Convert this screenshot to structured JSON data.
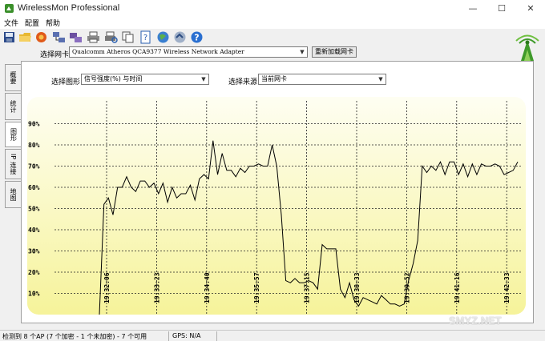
{
  "window": {
    "title": "WirelessMon Professional",
    "minimize": "—",
    "maximize": "☐",
    "close": "✕"
  },
  "menu": [
    "文件",
    "配置",
    "帮助"
  ],
  "toolbar": {
    "icons": [
      "save-icon",
      "open-folder-icon",
      "record-icon",
      "network-icon",
      "adapter-icon",
      "print-icon",
      "print-preview-icon",
      "copy-icon",
      "info-icon",
      "globe-icon",
      "connect-icon",
      "help-icon"
    ]
  },
  "adapter": {
    "label": "选择网卡",
    "selected": "Qualcomm Atheros QCA9377 Wireless Network Adapter",
    "reload": "重新加载网卡"
  },
  "tabs": [
    "概要",
    "统计",
    "图形",
    "IP 连接",
    "地图"
  ],
  "graph_controls": {
    "graph_label": "选择图形",
    "graph_selected": "信号强度(%) 与时间",
    "source_label": "选择来源",
    "source_selected": "当前网卡"
  },
  "chart_data": {
    "type": "line",
    "ylabels": [
      "10%",
      "20%",
      "30%",
      "40%",
      "50%",
      "60%",
      "70%",
      "80%",
      "90%"
    ],
    "xlabels": [
      "19:32:06",
      "19:33:23",
      "19:34:40",
      "19:35:57",
      "19:37:15",
      "19:38:33",
      "19:39:52",
      "19:41:16",
      "19:42:33"
    ],
    "ylim": [
      0,
      100
    ],
    "grid": true,
    "series": [
      {
        "values": [
          0,
          52,
          55,
          47,
          60,
          60,
          65,
          60,
          58,
          63,
          63,
          60,
          62,
          57,
          62,
          53,
          60,
          55,
          57,
          57,
          61,
          54,
          64,
          66,
          64,
          82,
          66,
          76,
          68,
          68,
          65,
          69,
          67,
          70,
          70,
          71,
          70,
          70,
          80,
          70,
          47,
          16,
          15,
          17,
          15,
          15,
          16,
          15,
          12,
          33,
          31,
          31,
          31,
          12,
          8,
          15,
          7,
          4,
          8,
          7,
          6,
          5,
          9,
          7,
          5,
          5,
          4,
          5,
          16,
          24,
          35,
          70,
          67,
          70,
          68,
          72,
          66,
          72,
          72,
          66,
          71,
          65,
          71,
          66,
          71,
          70,
          70,
          71,
          70,
          66,
          67,
          68,
          72
        ]
      }
    ]
  },
  "status": {
    "ap_info": "检测到 8 个AP (7 个加密 - 1 个未加密) - 7 个可用",
    "gps": "GPS: N/A"
  },
  "watermark": "SMYZ.NET"
}
